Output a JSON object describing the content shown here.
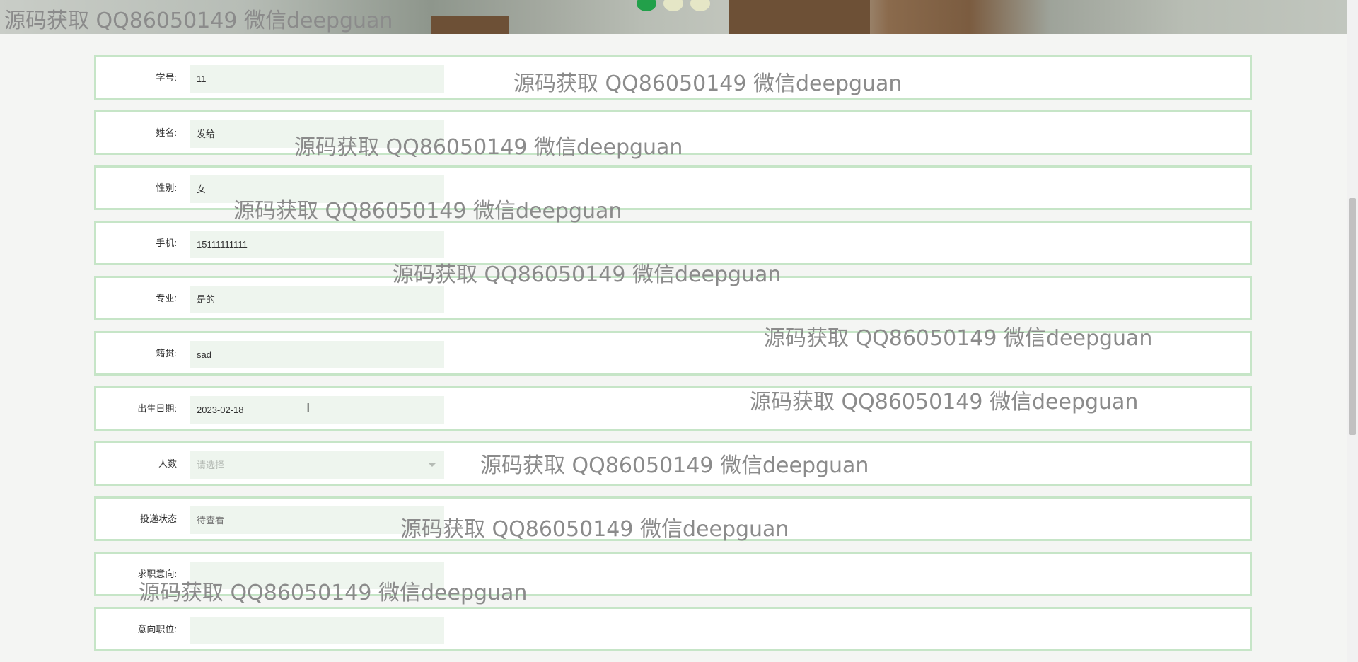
{
  "watermark_text": "源码获取 QQ86050149 微信deepguan",
  "banner": {
    "slides": 3,
    "active_slide": 1
  },
  "form": {
    "rows": [
      {
        "label": "学号:",
        "value": "11",
        "placeholder": ""
      },
      {
        "label": "姓名:",
        "value": "发给",
        "placeholder": ""
      },
      {
        "label": "性别:",
        "value": "女",
        "placeholder": ""
      },
      {
        "label": "手机:",
        "value": "15111111111",
        "placeholder": ""
      },
      {
        "label": "专业:",
        "value": "是的",
        "placeholder": ""
      },
      {
        "label": "籍贯:",
        "value": "sad",
        "placeholder": ""
      },
      {
        "label": "出生日期:",
        "value": "2023-02-18",
        "placeholder": ""
      },
      {
        "label": "人数",
        "value": "",
        "placeholder": "请选择"
      },
      {
        "label": "投递状态",
        "value": "",
        "placeholder": "待查看"
      },
      {
        "label": "求职意向:",
        "value": "",
        "placeholder": ""
      },
      {
        "label": "意向职位:",
        "value": "",
        "placeholder": ""
      }
    ]
  },
  "colors": {
    "row_border": "#c6e5c7",
    "field_bg": "#eef5ee",
    "accent_dot": "#22a04a"
  }
}
